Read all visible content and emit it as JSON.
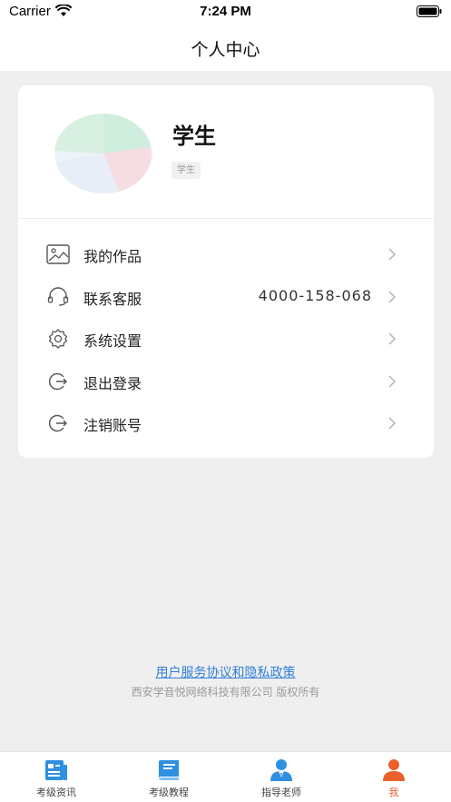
{
  "status_bar": {
    "carrier": "Carrier",
    "time": "7:24 PM"
  },
  "nav": {
    "title": "个人中心"
  },
  "profile": {
    "name": "学生",
    "role": "学生"
  },
  "menu": {
    "items": [
      {
        "label": "我的作品",
        "icon": "picture-icon",
        "value": ""
      },
      {
        "label": "联系客服",
        "icon": "headset-icon",
        "value": "4000-158-068"
      },
      {
        "label": "系统设置",
        "icon": "gear-icon",
        "value": ""
      },
      {
        "label": "退出登录",
        "icon": "logout-icon",
        "value": ""
      },
      {
        "label": "注销账号",
        "icon": "logout-icon",
        "value": ""
      }
    ]
  },
  "footer": {
    "policy_link": "用户服务协议和隐私政策",
    "copyright": "西安学音悦网络科技有限公司 版权所有"
  },
  "tabs": [
    {
      "label": "考级资讯",
      "icon": "news-icon",
      "active": false
    },
    {
      "label": "考级教程",
      "icon": "book-icon",
      "active": false
    },
    {
      "label": "指导老师",
      "icon": "teacher-icon",
      "active": false
    },
    {
      "label": "我",
      "icon": "person-icon",
      "active": true
    }
  ],
  "colors": {
    "accent": "#e8602c",
    "tab_icon": "#2f8fe0",
    "link": "#2f7fd8"
  }
}
